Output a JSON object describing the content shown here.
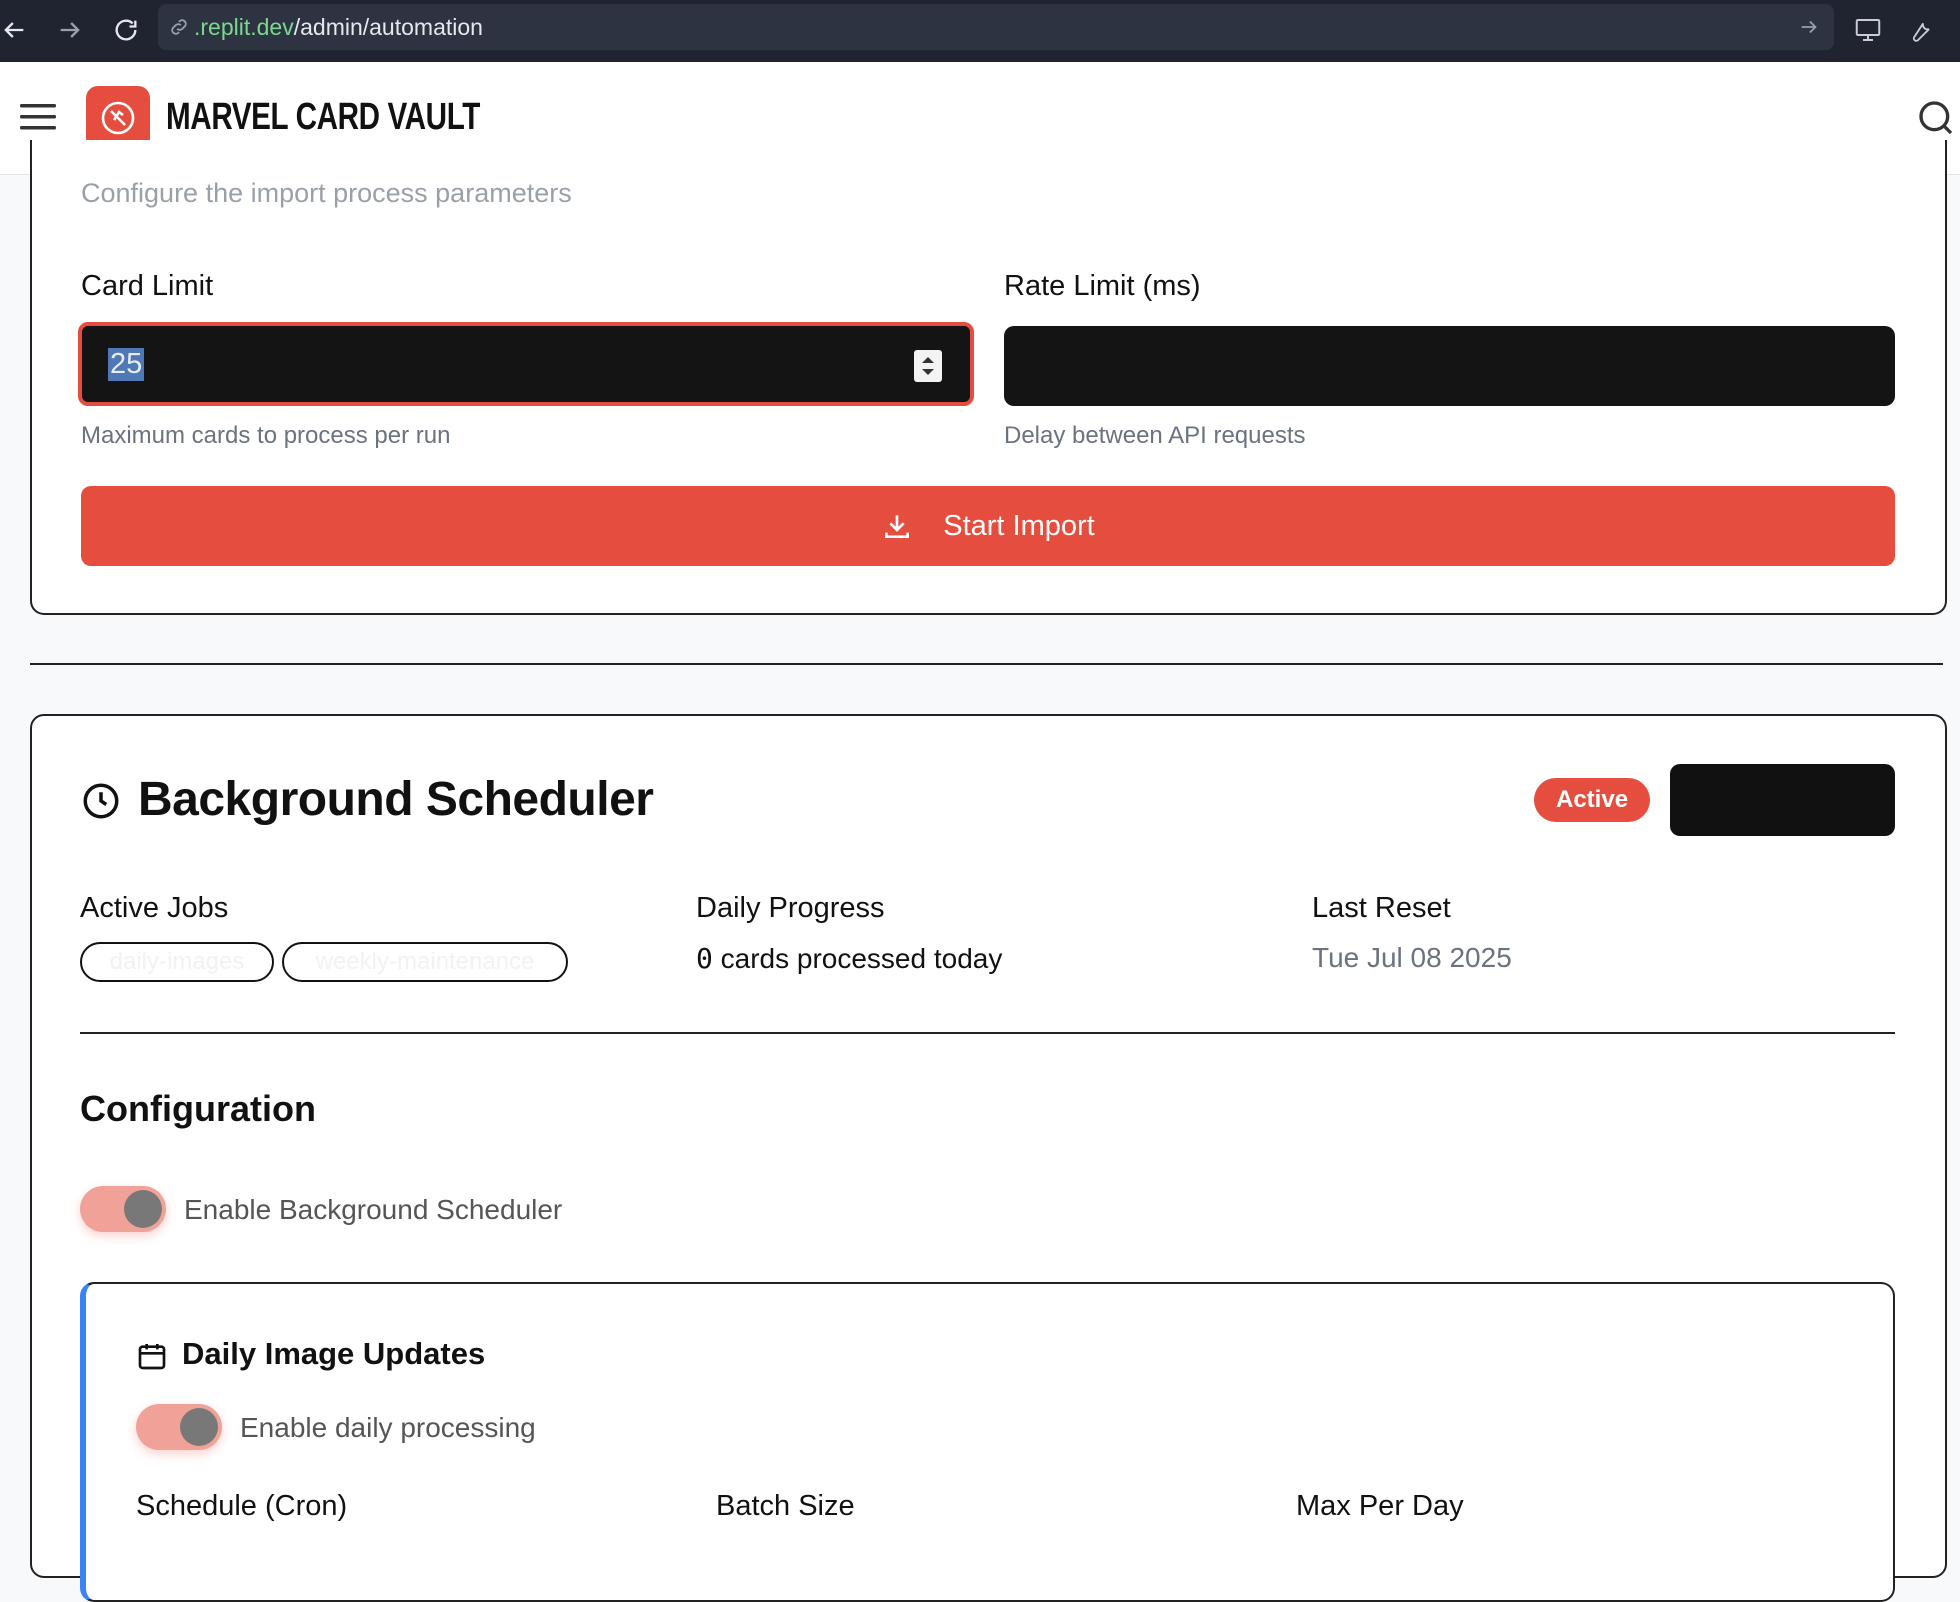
{
  "browser": {
    "url_host": ".replit.dev",
    "url_path": "/admin/automation"
  },
  "header": {
    "brand": "Marvel Card Vault",
    "icons": [
      "menu-icon",
      "logo-icon",
      "search-icon"
    ]
  },
  "import_card": {
    "subtitle": "Configure the import process parameters",
    "card_limit": {
      "label": "Card Limit",
      "value": "25",
      "help": "Maximum cards to process per run"
    },
    "rate_limit": {
      "label": "Rate Limit (ms)",
      "value": "",
      "help": "Delay between API requests"
    },
    "start_button": "Start Import"
  },
  "scheduler": {
    "title": "Background Scheduler",
    "status_badge": "Active",
    "status_color": "#e54d3e",
    "action_button": "",
    "active_jobs": {
      "label": "Active Jobs",
      "jobs": [
        "daily-images",
        "weekly-maintenance"
      ]
    },
    "daily_progress": {
      "label": "Daily Progress",
      "count": "0",
      "text": "cards processed today"
    },
    "last_reset": {
      "label": "Last Reset",
      "value": "Tue Jul 08 2025"
    },
    "configuration": {
      "heading": "Configuration",
      "enable_label": "Enable Background Scheduler",
      "enabled": true
    },
    "daily_updates": {
      "title": "Daily Image Updates",
      "enable_label": "Enable daily processing",
      "enabled": true,
      "columns": [
        "Schedule (Cron)",
        "Batch Size",
        "Max Per Day"
      ],
      "accent_color": "#3b82f6"
    }
  }
}
